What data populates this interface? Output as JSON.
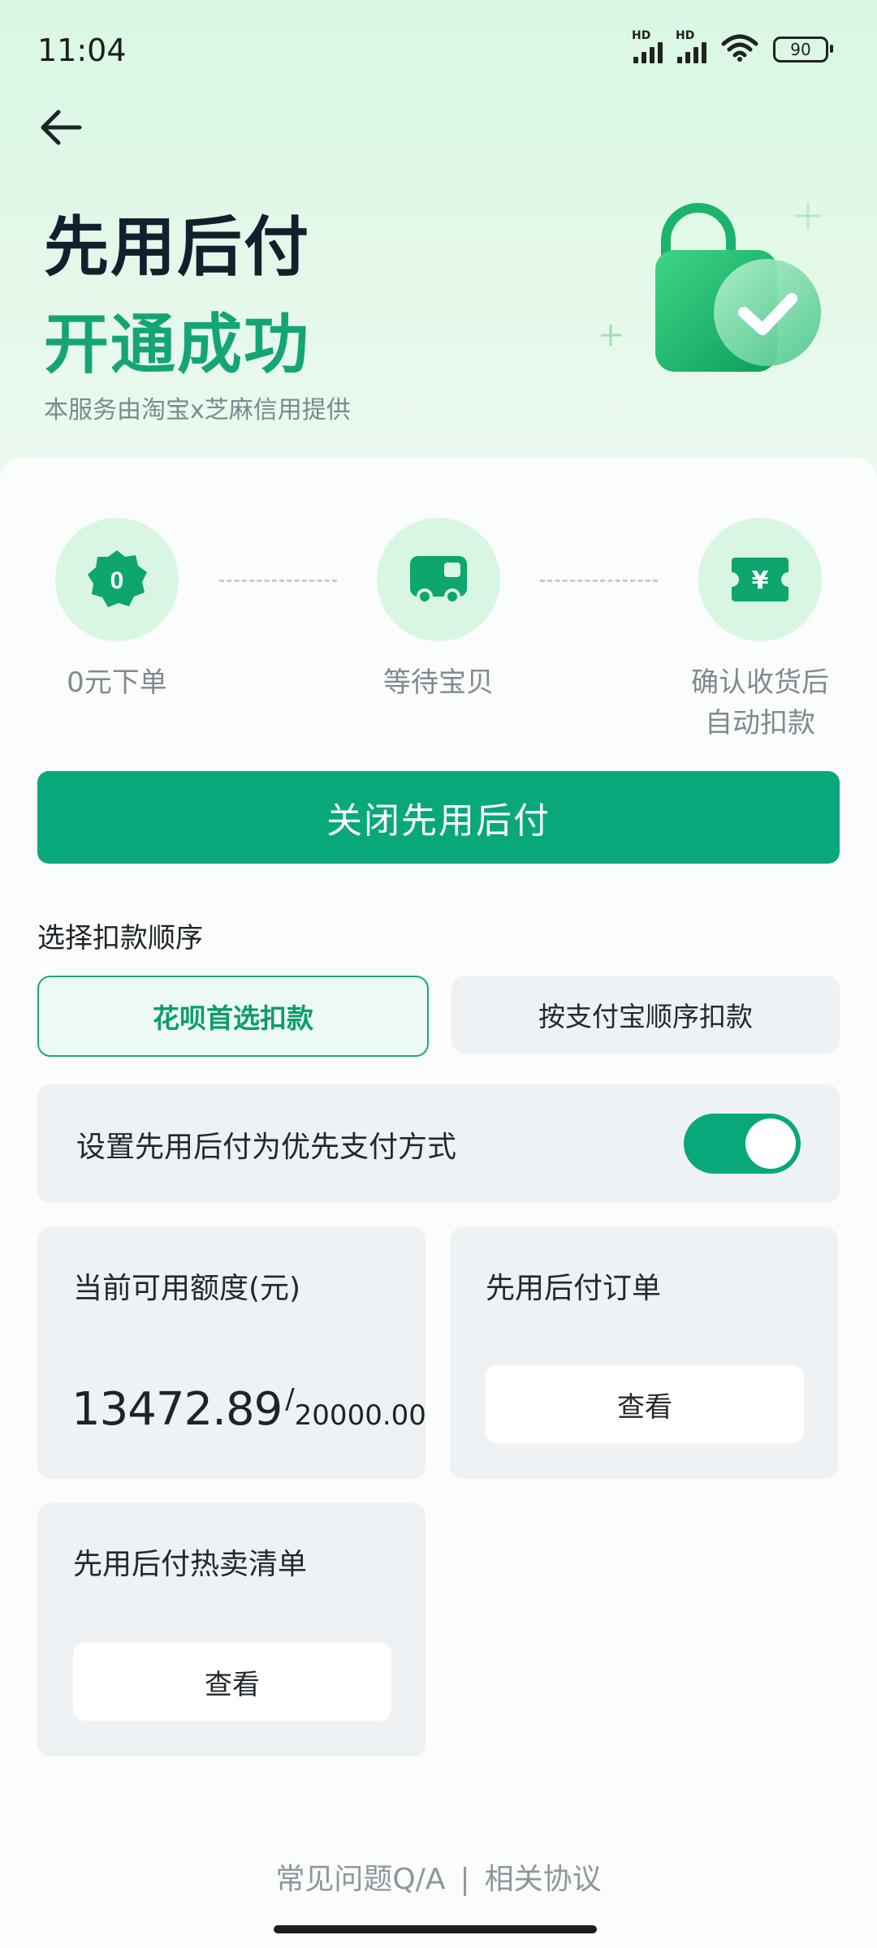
{
  "status_bar": {
    "time": "11:04",
    "signal1_label": "HD",
    "signal2_label": "HD",
    "battery": "90"
  },
  "header": {
    "back_icon": "arrow-left-icon",
    "title_line1": "先用后付",
    "title_line2": "开通成功",
    "provider_text": "本服务由淘宝x芝麻信用提供",
    "hero_icon": "shopping-bag-check-icon"
  },
  "steps": [
    {
      "icon": "zero-badge-icon",
      "icon_text": "0",
      "label": "0元下单"
    },
    {
      "icon": "delivery-truck-icon",
      "label": "等待宝贝"
    },
    {
      "icon": "yuan-ticket-icon",
      "icon_text": "¥",
      "label_line1": "确认收货后",
      "label_line2": "自动扣款"
    }
  ],
  "close_button": {
    "label": "关闭先用后付"
  },
  "payment_order": {
    "title": "选择扣款顺序",
    "options": [
      {
        "label": "花呗首选扣款",
        "selected": true
      },
      {
        "label": "按支付宝顺序扣款",
        "selected": false
      }
    ]
  },
  "priority_setting": {
    "label": "设置先用后付为优先支付方式",
    "enabled": true
  },
  "credit_tile": {
    "title": "当前可用额度(元)",
    "available": "13472.89",
    "separator": "/",
    "total": "20000.00"
  },
  "orders_tile": {
    "title": "先用后付订单",
    "button": "查看"
  },
  "hotlist_tile": {
    "title": "先用后付热卖清单",
    "button": "查看"
  },
  "footer": {
    "faq": "常见问题Q/A",
    "divider": "|",
    "agreement": "相关协议"
  },
  "colors": {
    "accent": "#08a87b",
    "header_bg": "#d8f8e3",
    "card_bg": "#eef2f5"
  }
}
